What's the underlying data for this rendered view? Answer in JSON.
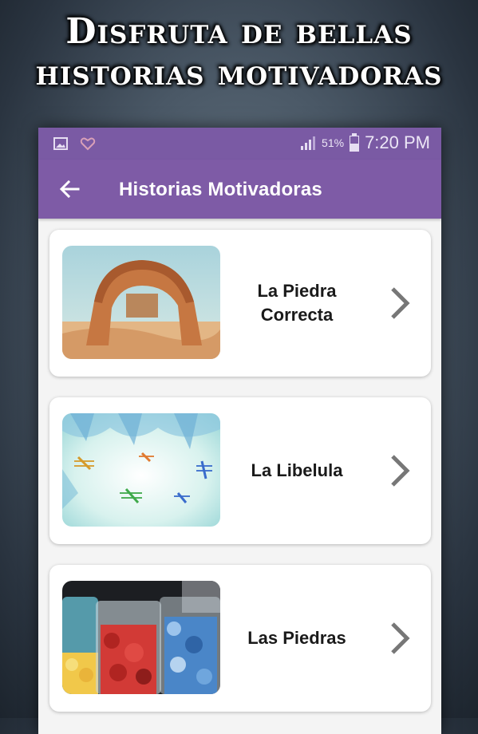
{
  "promo": {
    "line1": "Disfruta de bellas",
    "line2": "historias motivadoras"
  },
  "statusbar": {
    "battery": "51%",
    "time": "7:20 PM"
  },
  "toolbar": {
    "title": "Historias Motivadoras"
  },
  "stories": [
    {
      "title": "La Piedra Correcta",
      "thumb": "stone-arch-desert"
    },
    {
      "title": "La Libelula",
      "thumb": "dragonflies-leaves"
    },
    {
      "title": "Las Piedras",
      "thumb": "jars-of-stones"
    }
  ],
  "colors": {
    "primary": "#7e5ba6",
    "status_bar": "#7a5aa4",
    "card_bg": "#ffffff",
    "chevron": "#777777"
  }
}
